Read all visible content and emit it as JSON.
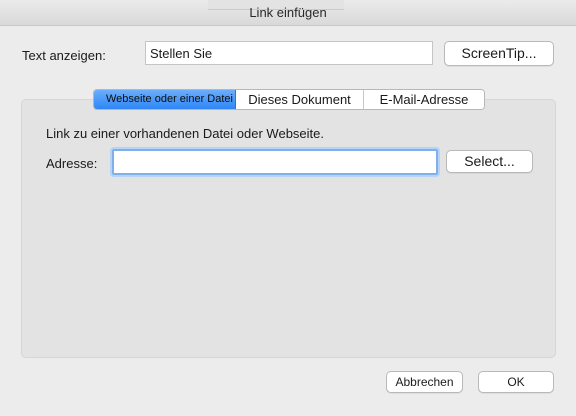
{
  "window": {
    "title": "Link einfügen"
  },
  "display": {
    "label": "Text anzeigen:",
    "value": "Stellen Sie",
    "screentip_label": "ScreenTip..."
  },
  "tabs": [
    {
      "label": "Webseite oder einer Datei",
      "selected": true
    },
    {
      "label": "Dieses Dokument",
      "selected": false
    },
    {
      "label": "E-Mail-Adresse",
      "selected": false
    }
  ],
  "web_panel": {
    "intro": "Link zu einer vorhandenen Datei oder Webseite.",
    "address_label": "Adresse:",
    "address_value": "",
    "select_label": "Select..."
  },
  "footer": {
    "cancel_label": "Abbrechen",
    "ok_label": "OK"
  },
  "colors": {
    "selected_tab": "#3a8ff7",
    "focus_ring": "#7fb0ee",
    "window_bg": "#ececec"
  }
}
